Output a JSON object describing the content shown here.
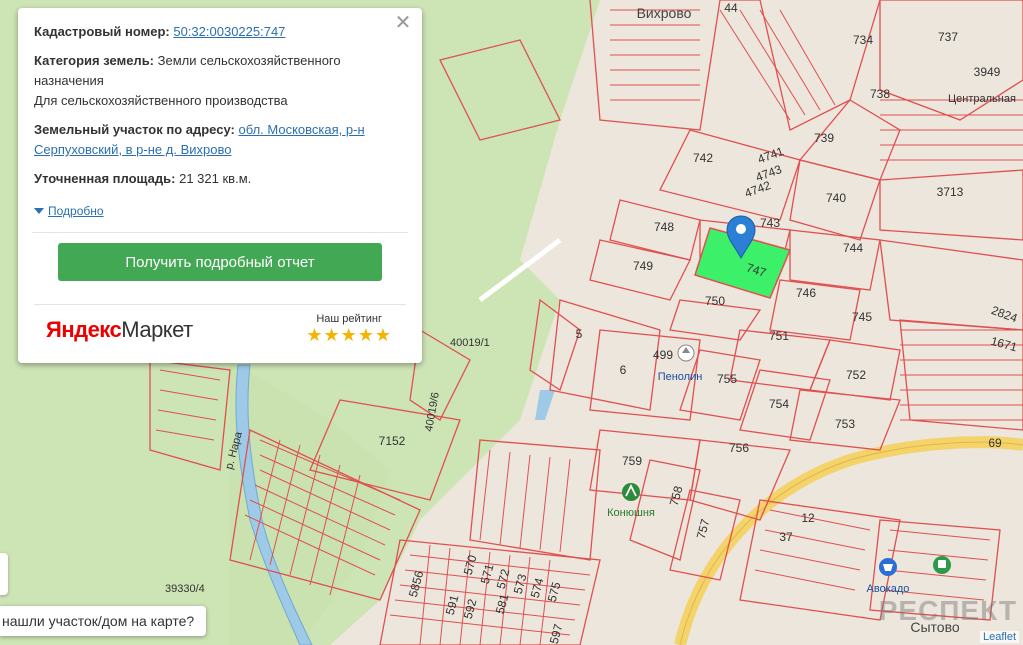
{
  "popup": {
    "cadastral_label": "Кадастровый номер:",
    "cadastral_number": "50:32:0030225:747",
    "category_label": "Категория земель:",
    "category_value_1": "Земли сельскохозяйственного назначения",
    "category_value_2": "Для сельскохозяйственного производства",
    "address_label": "Земельный участок по адресу:",
    "address_value": "обл. Московская, р-н Серпуховский, в р-не д. Вихрово",
    "area_label": "Уточненная площадь:",
    "area_value": "21 321 кв.м.",
    "details_link": "Подробно",
    "report_button": "Получить подробный отчет",
    "market_logo_1": "Яндекс",
    "market_logo_2": "Маркет",
    "rating_label": "Наш рейтинг",
    "stars": "★★★★★"
  },
  "ask_button": "нашли участок/дом на карте?",
  "attribution": "Leaflet",
  "watermark": "РЕСПЕКТ",
  "map": {
    "places": [
      "Вихрово",
      "Пенолин",
      "Конюшня",
      "Авокадо",
      "Сытово",
      "Центральная"
    ],
    "roads": [
      "р. Нара",
      "40019/1",
      "40019/6",
      "39330/4"
    ],
    "selected_parcel": "747",
    "parcels": [
      "745",
      "44",
      "734",
      "737",
      "3949",
      "738",
      "739",
      "742",
      "4741",
      "4743",
      "4742",
      "740",
      "3713",
      "748",
      "743",
      "744",
      "749",
      "746",
      "750",
      "2824",
      "5",
      "499",
      "751",
      "1671",
      "6",
      "755",
      "752",
      "754",
      "753",
      "7152",
      "756",
      "69",
      "759",
      "758",
      "757",
      "12",
      "37",
      "5856",
      "570",
      "571",
      "572",
      "573",
      "574",
      "575",
      "591",
      "592",
      "581",
      "597"
    ],
    "colors": {
      "background": "#e9e4dc",
      "forest": "#cfe6b8",
      "parcel_line": "#e05050",
      "selected": "#3cf06a",
      "river": "#9ecae8",
      "road": "#f3d36a",
      "marker": "#2b7fd4"
    }
  }
}
